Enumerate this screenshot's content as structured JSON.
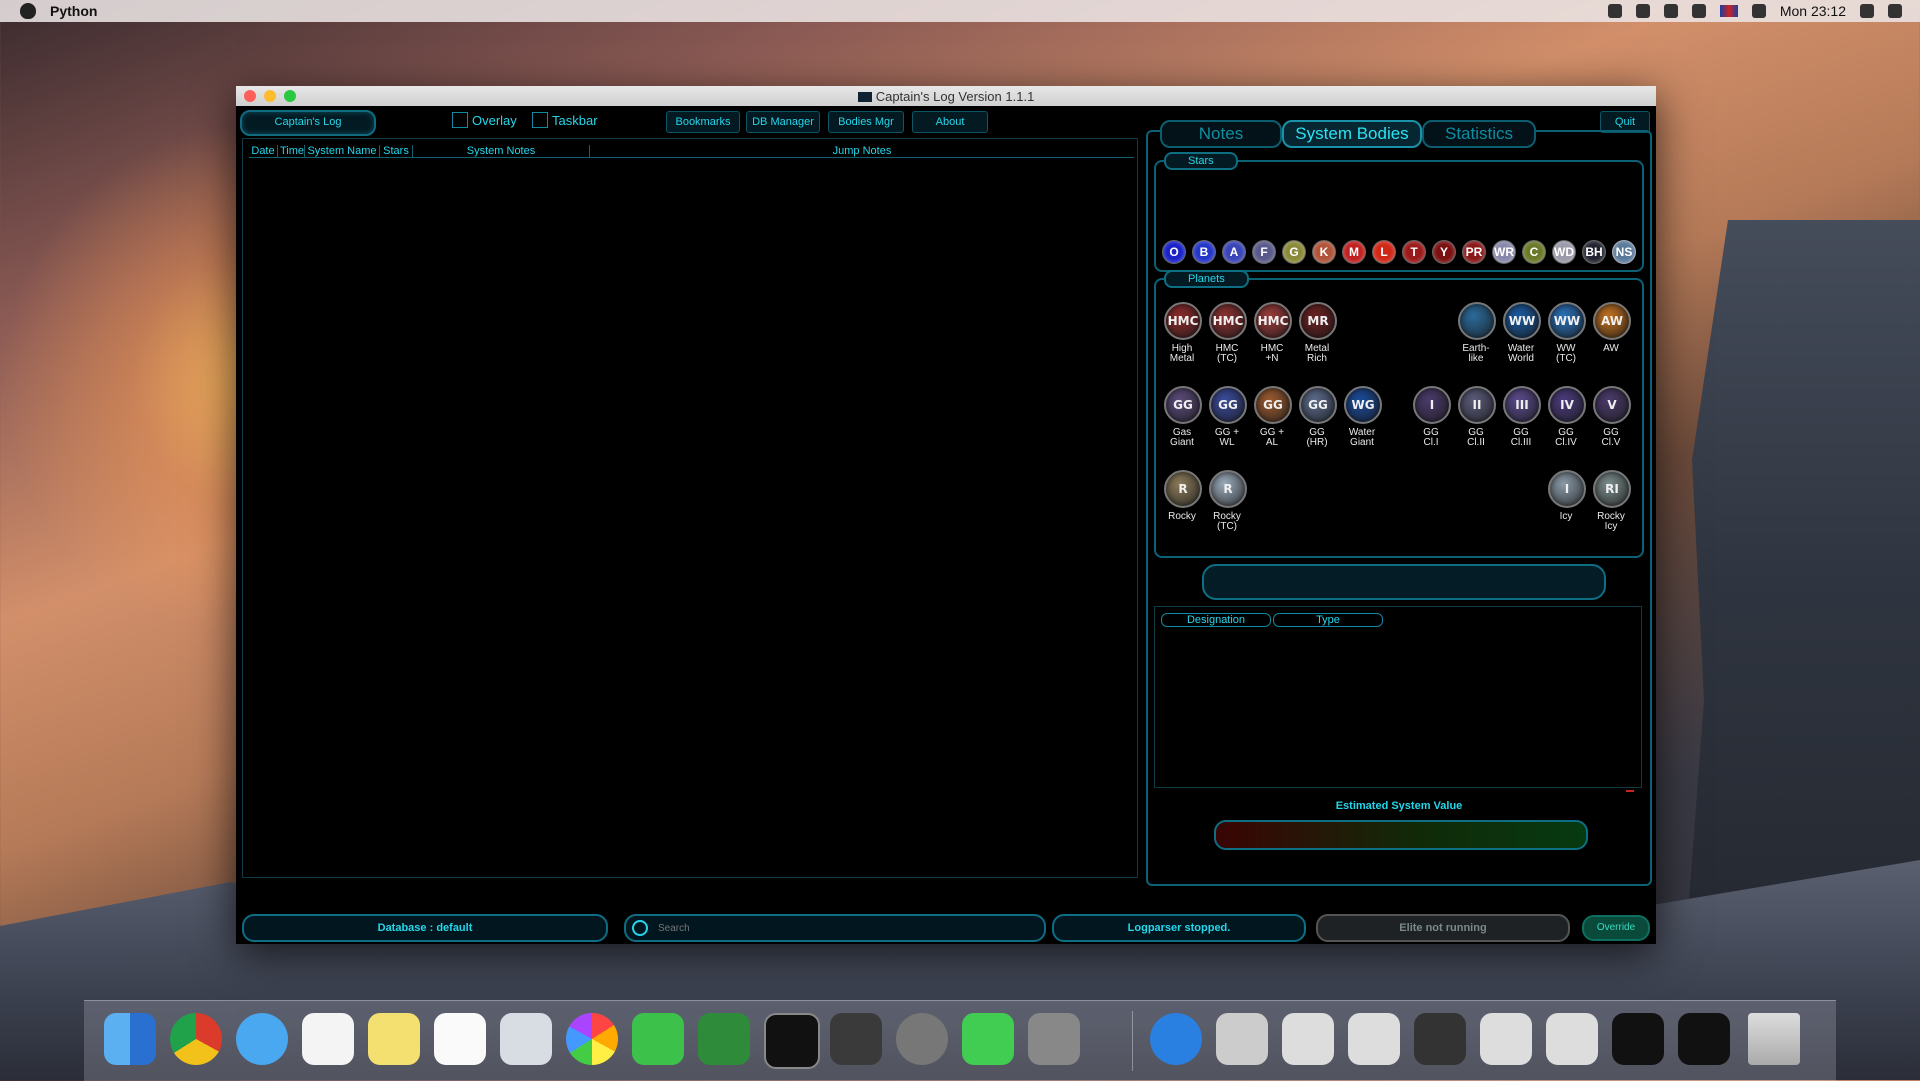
{
  "menubar": {
    "app_name": "Python",
    "clock": "Mon 23:12"
  },
  "window": {
    "title": "Captain's Log Version 1.1.1",
    "toolbar": {
      "captains_log": "Captain's Log",
      "overlay": "Overlay",
      "taskbar": "Taskbar",
      "bookmarks": "Bookmarks",
      "db_manager": "DB Manager",
      "bodies_mgr": "Bodies Mgr",
      "about": "About",
      "quit": "Quit"
    },
    "log_columns": [
      "Date",
      "Time",
      "System Name",
      "Stars",
      "System Notes",
      "Jump Notes"
    ],
    "tabs": [
      "Notes",
      "System Bodies",
      "Statistics"
    ],
    "active_tab": "System Bodies",
    "stars_label": "Stars",
    "stars": [
      {
        "label": "O",
        "color": "#1a22c8"
      },
      {
        "label": "B",
        "color": "#2436c8"
      },
      {
        "label": "A",
        "color": "#3a44b8"
      },
      {
        "label": "F",
        "color": "#5a5a8a"
      },
      {
        "label": "G",
        "color": "#8a8a3a"
      },
      {
        "label": "K",
        "color": "#b0543a"
      },
      {
        "label": "M",
        "color": "#c02020"
      },
      {
        "label": "L",
        "color": "#d02818"
      },
      {
        "label": "T",
        "color": "#9a1a1a"
      },
      {
        "label": "Y",
        "color": "#7a1010"
      },
      {
        "label": "PR",
        "color": "#8a1818"
      },
      {
        "label": "WR",
        "color": "#8888aa"
      },
      {
        "label": "C",
        "color": "#6a7a2a"
      },
      {
        "label": "WD",
        "color": "#9a9aa8"
      },
      {
        "label": "BH",
        "color": "#222230"
      },
      {
        "label": "NS",
        "color": "#5a7a9a"
      }
    ],
    "planets_label": "Planets",
    "planets_row1": [
      {
        "abbr": "HMC",
        "label": "High\nMetal",
        "color": "#8a2a2a"
      },
      {
        "abbr": "HMC",
        "label": "HMC\n(TC)",
        "color": "#8a3030"
      },
      {
        "abbr": "HMC",
        "label": "HMC\n+N",
        "color": "#9a3a3a"
      },
      {
        "abbr": "MR",
        "label": "Metal\nRich",
        "color": "#6a2020"
      }
    ],
    "planets_row1_right": [
      {
        "abbr": "",
        "label": "Earth-\nlike",
        "color": "#2a6a9a"
      },
      {
        "abbr": "WW",
        "label": "Water\nWorld",
        "color": "#1a5aa0"
      },
      {
        "abbr": "WW",
        "label": "WW\n(TC)",
        "color": "#2a70b8"
      },
      {
        "abbr": "AW",
        "label": "AW",
        "color": "#c07020"
      }
    ],
    "planets_row2": [
      {
        "abbr": "GG",
        "label": "Gas\nGiant",
        "color": "#5a4a7a"
      },
      {
        "abbr": "GG",
        "label": "GG +\nWL",
        "color": "#3a4a9a"
      },
      {
        "abbr": "GG",
        "label": "GG +\nAL",
        "color": "#9a5a30"
      },
      {
        "abbr": "GG",
        "label": "GG\n(HR)",
        "color": "#5a6a8a"
      },
      {
        "abbr": "WG",
        "label": "Water\nGiant",
        "color": "#1a4a9a"
      }
    ],
    "planets_row2_right": [
      {
        "abbr": "I",
        "label": "GG\nCl.I",
        "color": "#4a3a6a"
      },
      {
        "abbr": "II",
        "label": "GG\nCl.II",
        "color": "#5a5a7a"
      },
      {
        "abbr": "III",
        "label": "GG\nCl.III",
        "color": "#5a4a8a"
      },
      {
        "abbr": "IV",
        "label": "GG\nCl.IV",
        "color": "#4a3a7a"
      },
      {
        "abbr": "V",
        "label": "GG\nCl.V",
        "color": "#4a3a6a"
      }
    ],
    "planets_row3": [
      {
        "abbr": "R",
        "label": "Rocky",
        "color": "#8a7a5a"
      },
      {
        "abbr": "R",
        "label": "Rocky\n(TC)",
        "color": "#9aaaba"
      }
    ],
    "planets_row3_right": [
      {
        "abbr": "I",
        "label": "Icy",
        "color": "#8a9aa8"
      },
      {
        "abbr": "RI",
        "label": "Rocky\nIcy",
        "color": "#7a8a8a"
      }
    ],
    "bodies_columns": [
      "Designation",
      "Type"
    ],
    "estimated_value_label": "Estimated System Value",
    "status": {
      "database": "Database : default",
      "search_placeholder": "Search",
      "logparser": "Logparser stopped.",
      "elite": "Elite not running",
      "override": "Override"
    }
  }
}
